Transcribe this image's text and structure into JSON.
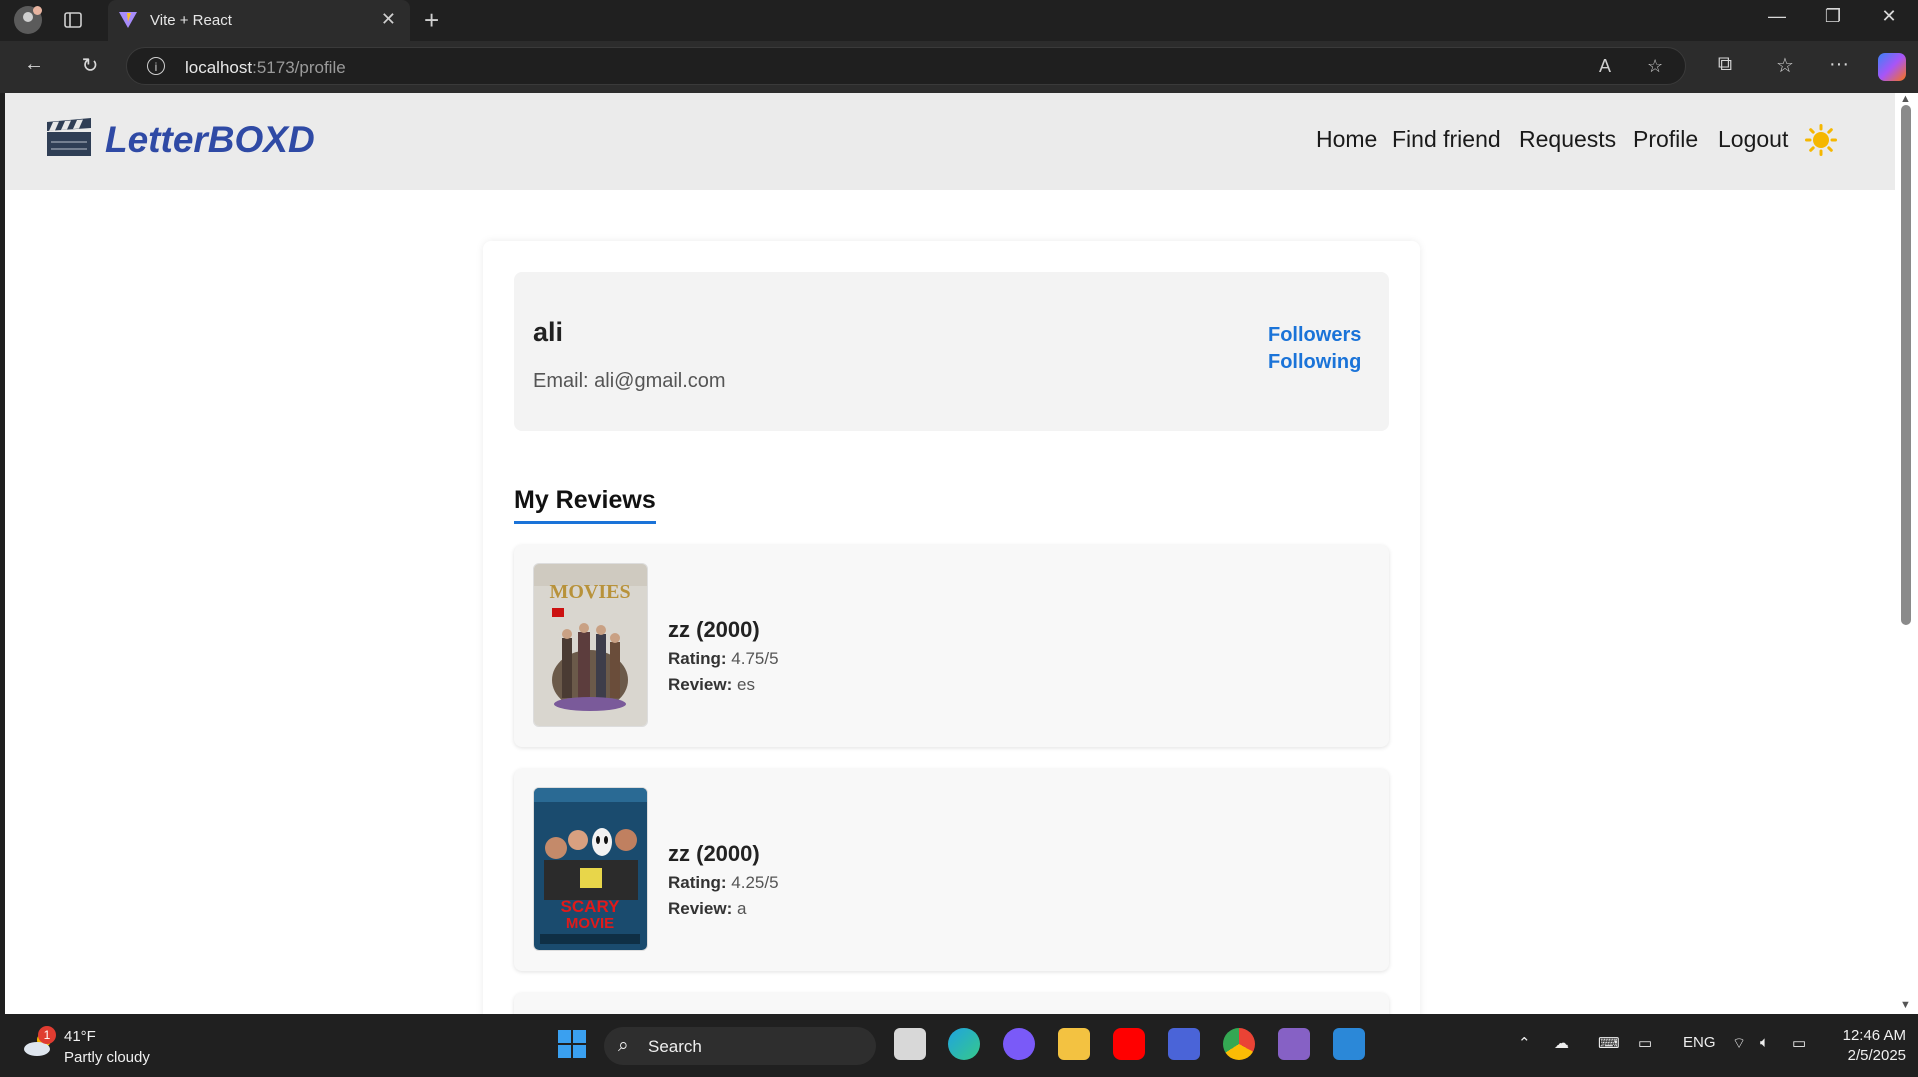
{
  "browser": {
    "tab_title": "Vite + React",
    "url_host": "localhost",
    "url_path": ":5173/profile"
  },
  "app": {
    "logo": "LetterBOXD",
    "nav": [
      "Home",
      "Find friend",
      "Requests",
      "Profile",
      "Logout"
    ],
    "accent": "#1a73d8",
    "brand": "#2f4aa5"
  },
  "profile": {
    "username": "ali",
    "email_label": "Email:",
    "email": "ali@gmail.com",
    "followers_link": "Followers",
    "following_link": "Following"
  },
  "reviews": {
    "heading": "My Reviews",
    "rating_label": "Rating:",
    "review_label": "Review:",
    "items": [
      {
        "title": "zz (2000)",
        "rating": "4.75/5",
        "review": "es",
        "poster": "movies-poster"
      },
      {
        "title": "zz (2000)",
        "rating": "4.25/5",
        "review": "a",
        "poster": "scary-movie-poster"
      }
    ]
  },
  "taskbar": {
    "temp": "41°F",
    "condition": "Partly cloudy",
    "weather_badge": "1",
    "search_label": "Search",
    "lang": "ENG",
    "time": "12:46 AM",
    "date": "2/5/2025"
  }
}
